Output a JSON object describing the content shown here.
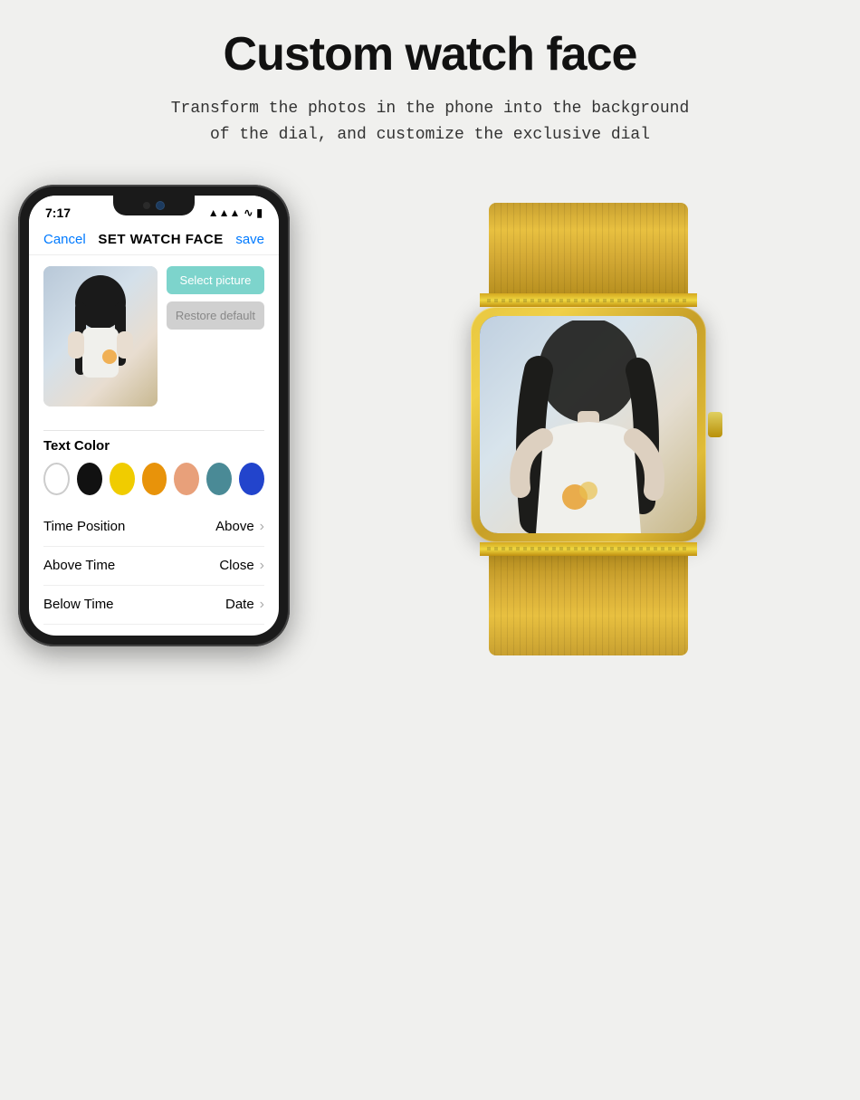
{
  "page": {
    "title": "Custom watch face",
    "subtitle_line1": "Transform the photos in the phone into the background",
    "subtitle_line2": "of the dial, and customize the exclusive dial"
  },
  "phone": {
    "status_time": "7:17",
    "signal_icon": "signal bars",
    "wifi_icon": "wifi",
    "battery_icon": "battery",
    "header": {
      "cancel": "Cancel",
      "title": "SET WATCH FACE",
      "save": "save"
    },
    "buttons": {
      "select_picture": "Select picture",
      "restore_default": "Restore default"
    },
    "text_color_label": "Text Color",
    "colors": [
      "white",
      "black",
      "yellow",
      "orange",
      "peach",
      "teal",
      "blue"
    ],
    "settings": [
      {
        "label": "Time Position",
        "value": "Above"
      },
      {
        "label": "Above Time",
        "value": "Close"
      },
      {
        "label": "Below Time",
        "value": "Date"
      }
    ]
  }
}
